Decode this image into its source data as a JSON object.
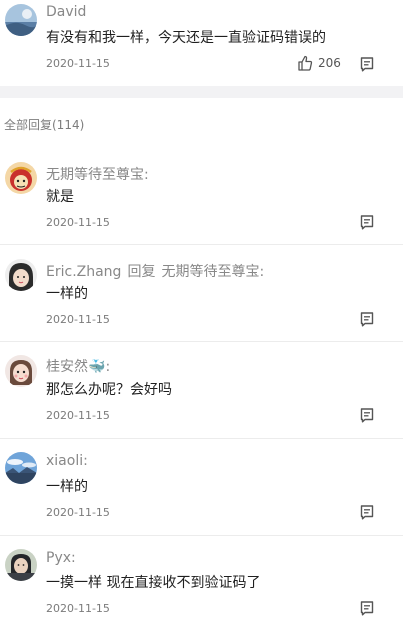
{
  "top_comment": {
    "user": "David",
    "content": "有没有和我一样，今天还是一直验证码错误的",
    "date": "2020-11-15",
    "likes": "206"
  },
  "section": {
    "label": "全部回复(114)"
  },
  "replies": [
    {
      "user": "无期等待至尊宝",
      "colon": ":",
      "content": "就是",
      "date": "2020-11-15"
    },
    {
      "user": "Eric.Zhang",
      "reply_word": "回复",
      "reply_to": "无期等待至尊宝",
      "colon": ":",
      "content": "一样的",
      "date": "2020-11-15"
    },
    {
      "user": "桂安然",
      "emoji": "🐳",
      "colon": ":",
      "content": "那怎么办呢？会好吗",
      "date": "2020-11-15"
    },
    {
      "user": "xiaoli",
      "colon": ":",
      "content": "一样的",
      "date": "2020-11-15"
    },
    {
      "user": "Pyx",
      "colon": ":",
      "content": "一摸一样 现在直接收不到验证码了",
      "date": "2020-11-15"
    }
  ],
  "icons": {
    "like": "thumbs-up-icon",
    "reply": "comment-icon"
  },
  "colors": {
    "username": "#888888",
    "content": "#1f1f1f",
    "date": "#7b7b7b",
    "band": "#f2f2f4"
  }
}
